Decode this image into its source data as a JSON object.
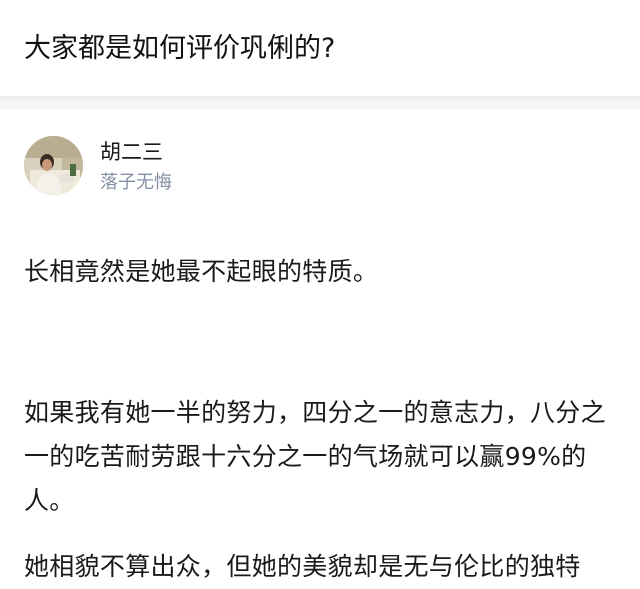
{
  "question": {
    "title": "大家都是如何评价巩俐的?"
  },
  "author": {
    "name": "胡二三",
    "bio": "落子无悔"
  },
  "answer": {
    "paragraphs": [
      "长相竟然是她最不起眼的特质。",
      "如果我有她一半的努力，四分之一的意志力，八分之一的吃苦耐劳跟十六分之一的气场就可以赢99%的人。",
      "她相貌不算出众，但她的美貌却是无与伦比的独特"
    ]
  }
}
